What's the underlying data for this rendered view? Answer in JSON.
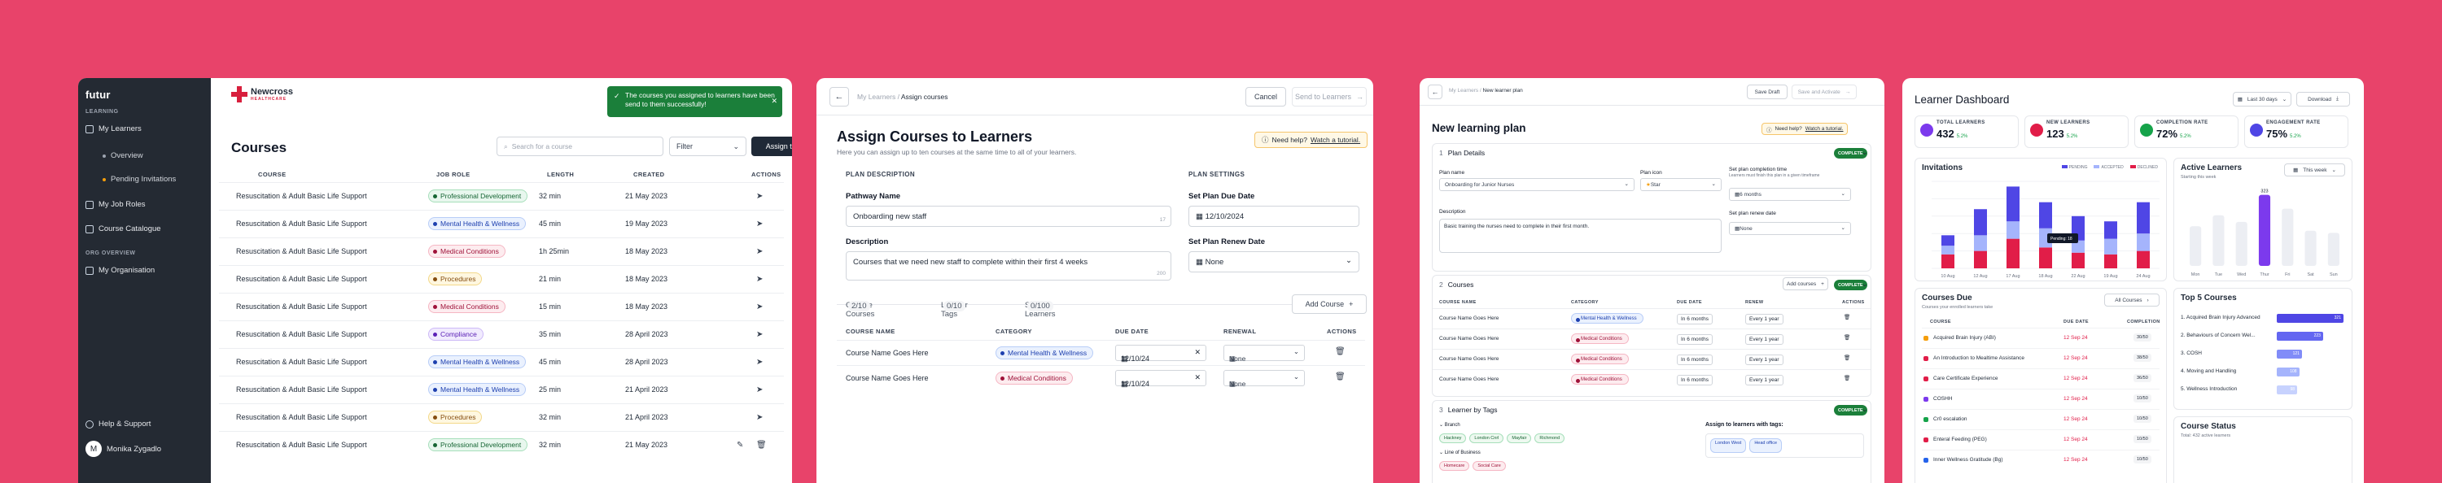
{
  "w1": {
    "brand": "futur",
    "sidebar": {
      "section_learning": "LEARNING",
      "my_learners": "My Learners",
      "overview": "Overview",
      "pending": "Pending Invitations",
      "my_job_roles": "My Job Roles",
      "course_catalogue": "Course Catalogue",
      "section_org": "ORG OVERVIEW",
      "my_org": "My Organisation",
      "help": "Help & Support",
      "user": "Monika Zygadlo",
      "user_initial": "M"
    },
    "org_logo": "Newcross",
    "org_logo_sub": "HEALTHCARE",
    "toast": "The courses you assigned to learners have been send to them successfully!",
    "title": "Courses",
    "search_placeholder": "Search for a course",
    "filter": "Filter",
    "assign_btn": "Assign  to learners",
    "headers": [
      "COURSE",
      "JOB ROLE",
      "LENGTH",
      "CREATED",
      "ACTIONS"
    ],
    "rows": [
      {
        "course": "Resuscitation & Adult Basic Life Support",
        "role": "Professional Development",
        "color": "green",
        "length": "32 min",
        "created": "21 May 2023"
      },
      {
        "course": "Resuscitation & Adult Basic Life Support",
        "role": "Mental Health & Wellness",
        "color": "blue",
        "length": "45 min",
        "created": "19 May 2023"
      },
      {
        "course": "Resuscitation & Adult Basic Life Support",
        "role": "Medical Conditions",
        "color": "red",
        "length": "1h 25min",
        "created": "18 May 2023"
      },
      {
        "course": "Resuscitation & Adult Basic Life Support",
        "role": "Procedures",
        "color": "yellow",
        "length": "21 min",
        "created": "18 May 2023"
      },
      {
        "course": "Resuscitation & Adult Basic Life Support",
        "role": "Medical Conditions",
        "color": "red",
        "length": "15 min",
        "created": "18 May 2023"
      },
      {
        "course": "Resuscitation & Adult Basic Life Support",
        "role": "Compliance",
        "color": "purple",
        "length": "35 min",
        "created": "28 April 2023"
      },
      {
        "course": "Resuscitation & Adult Basic Life Support",
        "role": "Mental Health & Wellness",
        "color": "blue",
        "length": "45 min",
        "created": "28 April 2023"
      },
      {
        "course": "Resuscitation & Adult Basic Life Support",
        "role": "Mental Health & Wellness",
        "color": "blue",
        "length": "25 min",
        "created": "21 April 2023"
      },
      {
        "course": "Resuscitation & Adult Basic Life Support",
        "role": "Procedures",
        "color": "yellow",
        "length": "32 min",
        "created": "21 April 2023"
      },
      {
        "course": "Resuscitation & Adult Basic Life Support",
        "role": "Professional Development",
        "color": "green",
        "length": "32 min",
        "created": "21 May 2023"
      }
    ]
  },
  "w2": {
    "crumb_parent": "My Learners",
    "crumb_current": "Assign courses",
    "cancel": "Cancel",
    "send": "Send to Learners",
    "title": "Assign Courses to Learners",
    "subtitle": "Here you can assign up to ten courses at the same time to all of your learners.",
    "help": "Need help?",
    "help_link": "Watch a tutorial.",
    "sec_desc": "PLAN DESCRIPTION",
    "sec_settings": "PLAN SETTINGS",
    "pathway_label": "Pathway Name",
    "pathway_value": "Onboarding new staff",
    "pathway_count": "17",
    "desc_label": "Description",
    "desc_value": "Courses that we need new staff to complete within their first 4 weeks",
    "desc_count": "200",
    "due_label": "Set Plan Due Date",
    "due_value": "12/10/2024",
    "renew_label": "Set Plan Renew Date",
    "renew_value": "None",
    "tab1": "Choose Courses",
    "tab1_count": "2/10",
    "tab2": "Learner Tags",
    "tab2_count": "0/10",
    "tab3": "Specific Learners",
    "tab3_count": "0/100",
    "add_course": "Add Course",
    "headers": [
      "COURSE NAME",
      "CATEGORY",
      "DUE DATE",
      "RENEWAL",
      "ACTIONS"
    ],
    "rows": [
      {
        "name": "Course Name Goes Here",
        "cat": "Mental Health & Wellness",
        "color": "blue",
        "due": "12/10/24",
        "renew": "None"
      },
      {
        "name": "Course Name Goes Here",
        "cat": "Medical Conditions",
        "color": "red",
        "due": "12/10/24",
        "renew": "None"
      }
    ]
  },
  "w3": {
    "crumb_parent": "My Learners",
    "crumb_current": "New learner plan",
    "save_draft": "Save Draft",
    "save_activate": "Save and Activate",
    "title": "New learning plan",
    "help": "Need help?",
    "help_link": "Watch a tutorial.",
    "s1": "Plan Details",
    "s1_num": "1",
    "complete": "COMPLETE",
    "plan_name_label": "Plan name",
    "plan_name": "Onboarding for Junior Nurses",
    "plan_icon_label": "Plan icon",
    "plan_icon": "Star",
    "completion_label": "Set plan completion time",
    "completion_sub": "Learners must finish this plan in a given timeframe",
    "completion_value": "6 months",
    "desc_label": "Description",
    "desc_value": "Basic training the nurses need to complete in their first month.",
    "renew_label": "Set plan renew date",
    "renew_value": "None",
    "s2": "Courses",
    "s2_num": "2",
    "add_courses": "Add courses",
    "headers": [
      "COURSE NAME",
      "CATEGORY",
      "DUE DATE",
      "RENEW",
      "ACTIONS"
    ],
    "rows": [
      {
        "name": "Course Name Goes Here",
        "cat": "Mental Health & Wellness",
        "color": "blue",
        "due": "In 6 months",
        "renew": "Every 1 year"
      },
      {
        "name": "Course Name Goes Here",
        "cat": "Medical Conditions",
        "color": "red",
        "due": "In 6 months",
        "renew": "Every 1 year"
      },
      {
        "name": "Course Name Goes Here",
        "cat": "Medical Conditions",
        "color": "red",
        "due": "In 6 months",
        "renew": "Every 1 year"
      },
      {
        "name": "Course Name Goes Here",
        "cat": "Medical Conditions",
        "color": "red",
        "due": "In 6 months",
        "renew": "Every 1 year"
      }
    ],
    "s3": "Learner by Tags",
    "s3_num": "3",
    "branch": "Branch",
    "branch_tags": [
      "Hackney",
      "London Cnrl",
      "Mayfair",
      "Richmond"
    ],
    "lob": "Line of Business",
    "lob_tags": [
      "Homecare",
      "Social Care"
    ],
    "assign_title": "Assign to learners with tags:",
    "assigned_tags": [
      "London West",
      "Head office"
    ]
  },
  "w4": {
    "title": "Learner Dashboard",
    "range": "Last 30 days",
    "download": "Download",
    "kpis": [
      {
        "label": "TOTAL LEARNERS",
        "value": "432",
        "delta": "5.2%",
        "color": "#7c3aed"
      },
      {
        "label": "NEW LEARNERS",
        "value": "123",
        "delta": "5.2%",
        "color": "#e11d48"
      },
      {
        "label": "COMPLETION RATE",
        "value": "72%",
        "delta": "5.2%",
        "color": "#16a34a"
      },
      {
        "label": "ENGAGEMENT RATE",
        "value": "75%",
        "delta": "5.2%",
        "color": "#4f46e5"
      }
    ],
    "invitations": "Invitations",
    "legend": [
      "PENDING",
      "ACCEPTED",
      "DECLINED"
    ],
    "tooltip": "Pending: 18",
    "active_learners": "Active Learners",
    "active_sub": "Starting this week",
    "this_week": "This week",
    "peak": "323",
    "courses_due": "Courses Due",
    "courses_due_sub": "Courses your enrolled learners take",
    "all_courses": "All Courses",
    "due_headers": [
      "COURSE",
      "DUE DATE",
      "COMPLETION"
    ],
    "due_rows": [
      {
        "course": "Acquired Brain Injury (ABI)",
        "date": "12 Sep 24",
        "pct": "30/50",
        "color": "#f59e0b"
      },
      {
        "course": "An Introduction to Mealtime Assistance",
        "date": "12 Sep 24",
        "pct": "38/50",
        "color": "#e11d48"
      },
      {
        "course": "Care Certificate Experience",
        "date": "12 Sep 24",
        "pct": "36/50",
        "color": "#e11d48"
      },
      {
        "course": "COSHH",
        "date": "12 Sep 24",
        "pct": "10/50",
        "color": "#7c3aed"
      },
      {
        "course": "Cr0 escalation",
        "date": "12 Sep 24",
        "pct": "10/50",
        "color": "#16a34a"
      },
      {
        "course": "Enteral Feeding (PEG)",
        "date": "12 Sep 24",
        "pct": "10/50",
        "color": "#e11d48"
      },
      {
        "course": "Inner Wellness Gratitude (Bg)",
        "date": "12 Sep 24",
        "pct": "10/50",
        "color": "#2563eb"
      }
    ],
    "top5": "Top 5 Courses",
    "top5_items": [
      {
        "name": "1. Acquired Brain Injury Advanced",
        "val": "321"
      },
      {
        "name": "2. Behaviours of Concern Wel...",
        "val": "223"
      },
      {
        "name": "3. COSH",
        "val": "121"
      },
      {
        "name": "4. Moving and Handling",
        "val": "108"
      },
      {
        "name": "5. Wellness Introduction",
        "val": "98"
      }
    ],
    "course_status": "Course Status",
    "course_status_sub": "Total: 432 active learners"
  },
  "chart_data": [
    {
      "type": "bar",
      "title": "Invitations",
      "categories": [
        "10 Aug",
        "12 Aug",
        "17 Aug",
        "18 Aug",
        "22 Aug",
        "19 Aug",
        "24 Aug"
      ],
      "series": [
        {
          "name": "PENDING",
          "values": [
            10,
            18,
            20,
            22,
            14,
            18,
            20
          ]
        },
        {
          "name": "ACCEPTED",
          "values": [
            12,
            30,
            40,
            30,
            28,
            20,
            36
          ]
        },
        {
          "name": "DECLINED",
          "values": [
            16,
            20,
            34,
            24,
            18,
            16,
            20
          ]
        }
      ],
      "ylim": [
        0,
        100
      ],
      "legend": "top-right"
    },
    {
      "type": "bar",
      "title": "Active Learners",
      "categories": [
        "Mon",
        "Tue",
        "Wed",
        "Thur",
        "Fri",
        "Sat",
        "Sun"
      ],
      "values": [
        180,
        230,
        200,
        323,
        260,
        160,
        150
      ],
      "ylim": [
        0,
        340
      ]
    }
  ]
}
